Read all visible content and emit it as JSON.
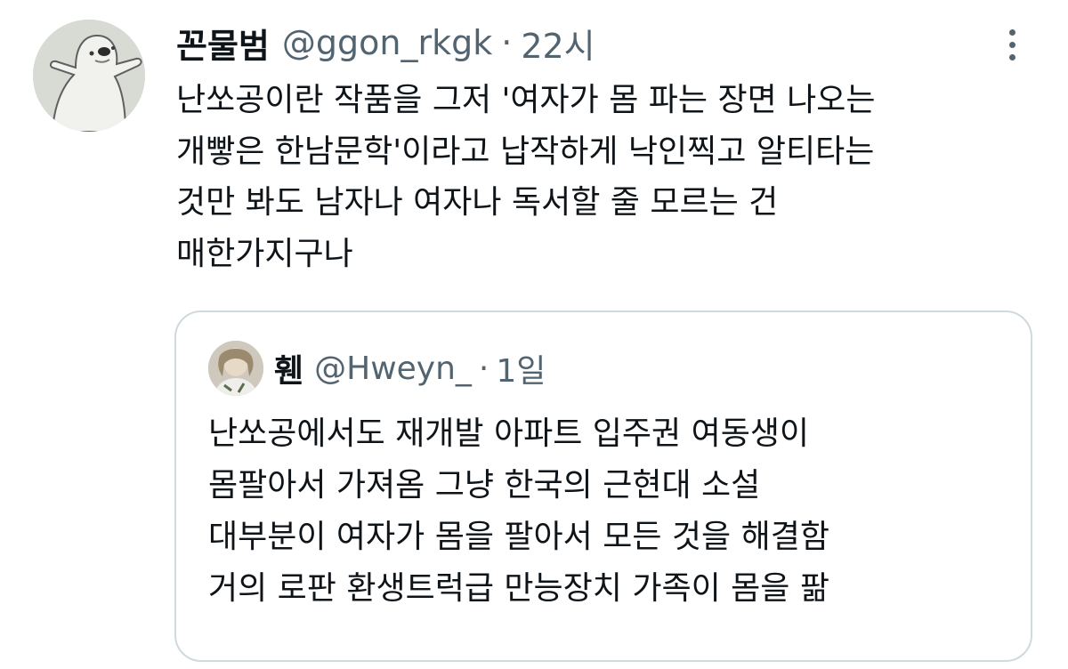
{
  "tweet": {
    "author_name": "꼰물범",
    "author_handle": "@ggon_rkgk",
    "separator": "·",
    "time": "22시",
    "lines": [
      "난쏘공이란 작품을 그저 '여자가 몸 파는 장면 나오는",
      "개빻은 한남문학'이라고 납작하게 낙인찍고 알티타는",
      "것만 봐도 남자나 여자나 독서할 줄 모르는 건",
      "매한가지구나"
    ]
  },
  "quote": {
    "author_name": "휀",
    "author_handle": "@Hweyn_",
    "separator": "·",
    "time": "1일",
    "lines": [
      "난쏘공에서도 재개발 아파트 입주권 여동생이",
      "몸팔아서 가져옴 그냥 한국의 근현대 소설",
      "대부분이 여자가 몸을 팔아서 모든 것을 해결함",
      "거의 로판 환생트럭급 만능장치 가족이 몸을 팖"
    ]
  },
  "icons": {
    "avatar": "seal-avatar-icon",
    "more": "more-options-icon",
    "quote_avatar": "user-photo-avatar"
  },
  "colors": {
    "text_primary": "#0f1419",
    "text_secondary": "#536471",
    "border": "#cfd9de"
  }
}
